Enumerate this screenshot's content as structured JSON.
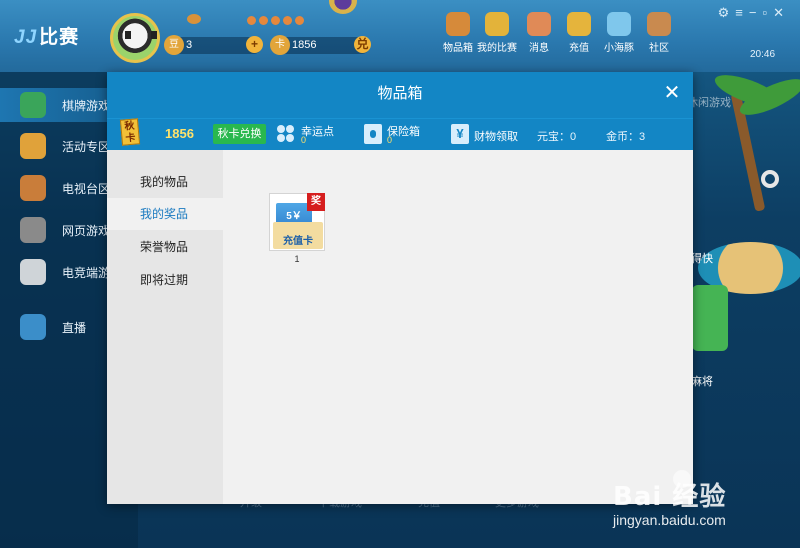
{
  "app": {
    "logo_text": "比赛",
    "bean_count": "3",
    "card_count": "1856",
    "plus": "+",
    "exchange_badge": "兑",
    "clock": "20:46",
    "top_icons": [
      {
        "label": "物品箱",
        "icon": "item-box-icon",
        "color": "#d68a3a"
      },
      {
        "label": "我的比赛",
        "icon": "trophy-icon",
        "color": "#e3b33a"
      },
      {
        "label": "消息",
        "icon": "message-icon",
        "color": "#e08a57"
      },
      {
        "label": "充值",
        "icon": "coin-icon",
        "color": "#e5b43c"
      },
      {
        "label": "小海豚",
        "icon": "dolphin-icon",
        "color": "#7fc7ec"
      },
      {
        "label": "社区",
        "icon": "community-icon",
        "color": "#c98a4f"
      }
    ],
    "sidebar": [
      {
        "label": "棋牌游戏",
        "icon": "cards-icon",
        "color": "#3aa55a"
      },
      {
        "label": "活动专区",
        "icon": "gift-icon",
        "color": "#e0a23a"
      },
      {
        "label": "电视台区",
        "icon": "tv-icon",
        "color": "#c97d3a"
      },
      {
        "label": "网页游戏",
        "icon": "shield-icon",
        "color": "#8a8a8a"
      },
      {
        "label": "电竞端游",
        "icon": "gamepad-icon",
        "color": "#cfd4d8"
      },
      {
        "label": "直播",
        "icon": "live-icon",
        "color": "#3b8ec9"
      }
    ],
    "right_labels": [
      "休闲游戏",
      "得快",
      "麻将"
    ],
    "bottom_links": [
      "升级",
      "下载游戏",
      "充值",
      "更多游戏"
    ]
  },
  "modal": {
    "title": "物品箱",
    "close": "✕",
    "card_icon_text": "秋卡",
    "card_value": "1856",
    "exchange_label": "秋卡兑换",
    "lucky_label": "幸运点",
    "lucky_value": "0",
    "safe_label": "保险箱",
    "safe_value": "0",
    "wealth_label": "财物领取",
    "yuanbao_label": "元宝：0",
    "gold_label": "金币：3",
    "nav": [
      "我的物品",
      "我的奖品",
      "荣誉物品",
      "即将过期"
    ],
    "active_nav": 1,
    "items": [
      {
        "name": "充值卡",
        "value_tag": "5￥",
        "reward_tag": "奖",
        "quantity": "1"
      }
    ]
  },
  "watermark": {
    "logo": "Bai 经验",
    "url": "jingyan.baidu.com"
  }
}
